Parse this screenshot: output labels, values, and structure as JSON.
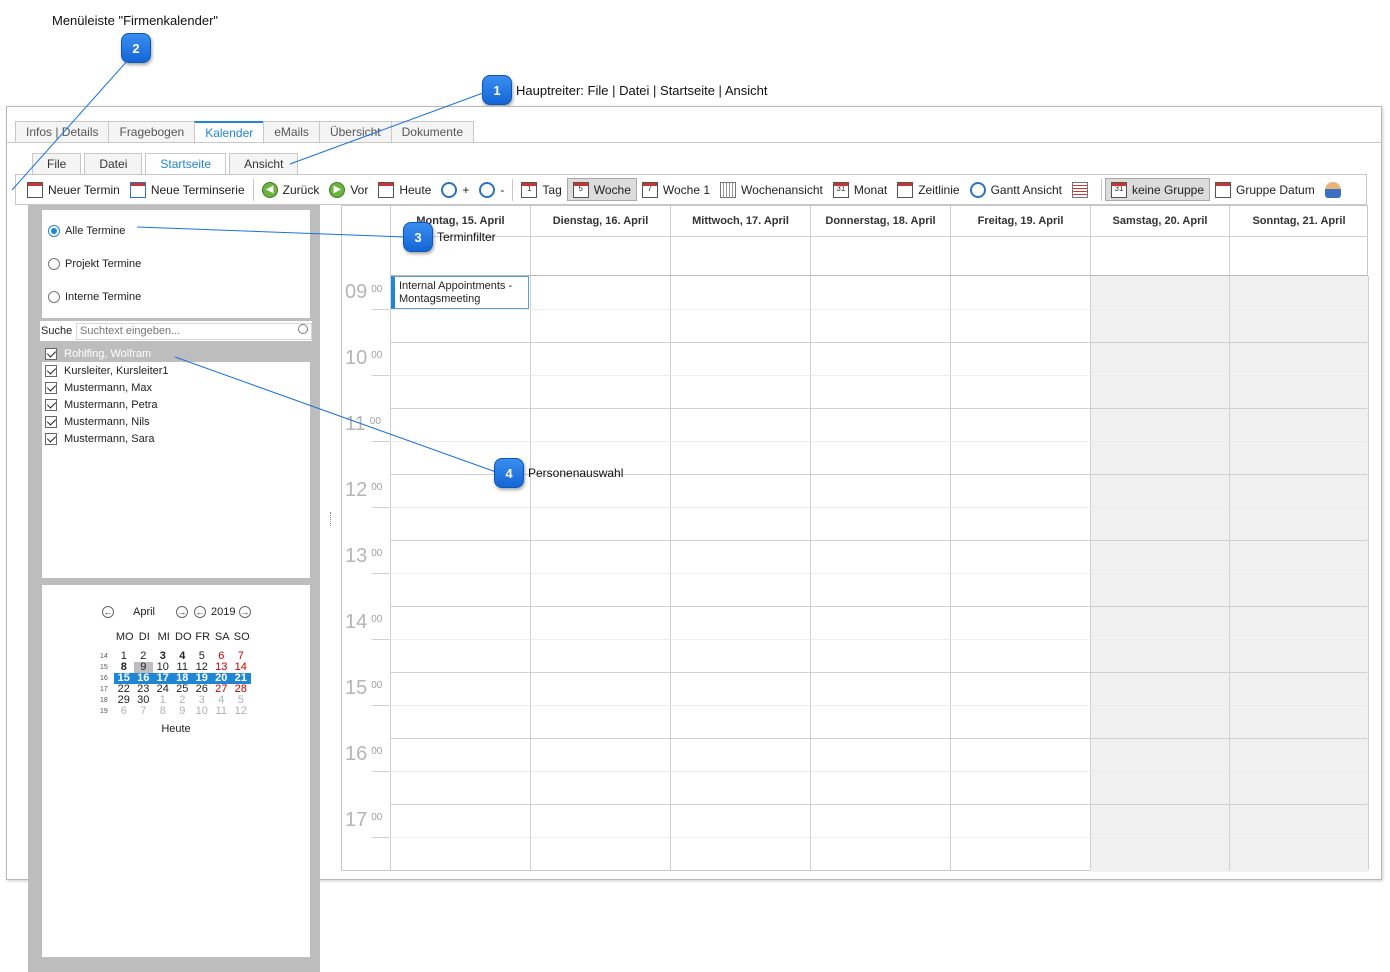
{
  "callouts": [
    {
      "num": "1",
      "text": "Hauptreiter: File | Datei | Startseite | Ansicht"
    },
    {
      "num": "2",
      "text": "Menüleiste \"Firmenkalender\""
    },
    {
      "num": "3",
      "text": "Terminfilter"
    },
    {
      "num": "4",
      "text": "Personenauswahl"
    }
  ],
  "main_tabs": [
    "Infos | Details",
    "Fragebogen",
    "Kalender",
    "eMails",
    "Übersicht",
    "Dokumente"
  ],
  "main_tab_active": "Kalender",
  "ribbon_tabs": [
    "File",
    "Datei",
    "Startseite",
    "Ansicht"
  ],
  "ribbon_tab_active": "Startseite",
  "toolbar": {
    "neuer_termin": "Neuer Termin",
    "neue_terminserie": "Neue Terminserie",
    "zurueck": "Zurück",
    "vor": "Vor",
    "heute": "Heute",
    "zoom_in": "+",
    "zoom_out": "-",
    "tag": "Tag",
    "woche": "Woche",
    "woche1": "Woche 1",
    "wochenansicht": "Wochenansicht",
    "monat": "Monat",
    "zeitlinie": "Zeitlinie",
    "gantt": "Gantt Ansicht",
    "keine_gruppe": "keine Gruppe",
    "gruppe_datum": "Gruppe Datum",
    "icon_tag": "1",
    "icon_woche": "5",
    "icon_woche1": "7",
    "icon_monat": "31",
    "icon_keine_gruppe": "31"
  },
  "filter": {
    "options": [
      "Alle Termine",
      "Projekt Termine",
      "Interne Termine"
    ],
    "selected": "Alle Termine"
  },
  "search": {
    "label": "Suche",
    "placeholder": "Suchtext eingeben..."
  },
  "persons": [
    {
      "name": "Rohlfing, Wolfram",
      "checked": true,
      "selected": true
    },
    {
      "name": "Kursleiter, Kursleiter1",
      "checked": true
    },
    {
      "name": "Mustermann, Max",
      "checked": true
    },
    {
      "name": "Mustermann, Petra",
      "checked": true
    },
    {
      "name": "Mustermann, Nils",
      "checked": true
    },
    {
      "name": "Mustermann, Sara",
      "checked": true
    }
  ],
  "minical": {
    "month": "April",
    "year": "2019",
    "weekdays": [
      "MO",
      "DI",
      "MI",
      "DO",
      "FR",
      "SA",
      "SO"
    ],
    "weeks": [
      {
        "wk": "14",
        "days": [
          "1",
          "2",
          "3",
          "4",
          "5",
          "6",
          "7"
        ]
      },
      {
        "wk": "15",
        "days": [
          "8",
          "9",
          "10",
          "11",
          "12",
          "13",
          "14"
        ]
      },
      {
        "wk": "16",
        "days": [
          "15",
          "16",
          "17",
          "18",
          "19",
          "20",
          "21"
        ]
      },
      {
        "wk": "17",
        "days": [
          "22",
          "23",
          "24",
          "25",
          "26",
          "27",
          "28"
        ]
      },
      {
        "wk": "18",
        "days": [
          "29",
          "30",
          "1",
          "2",
          "3",
          "4",
          "5"
        ]
      },
      {
        "wk": "19",
        "days": [
          "6",
          "7",
          "8",
          "9",
          "10",
          "11",
          "12"
        ]
      }
    ],
    "today_label": "Heute"
  },
  "calendar": {
    "days": [
      "Montag, 15. April",
      "Dienstag, 16. April",
      "Mittwoch, 17. April",
      "Donnerstag, 18. April",
      "Freitag, 19. April",
      "Samstag, 20. April",
      "Sonntag, 21. April"
    ],
    "hours": [
      "09",
      "10",
      "11",
      "12",
      "13",
      "14",
      "15",
      "16",
      "17"
    ],
    "minutes_label": "00",
    "appointment": "Internal Appointments - Montagsmeeting"
  },
  "colors": {
    "accent": "#1f86d6",
    "weekend": "#f0f0f0",
    "badge": "#1a72e0",
    "sunday_red": "#c00000"
  }
}
